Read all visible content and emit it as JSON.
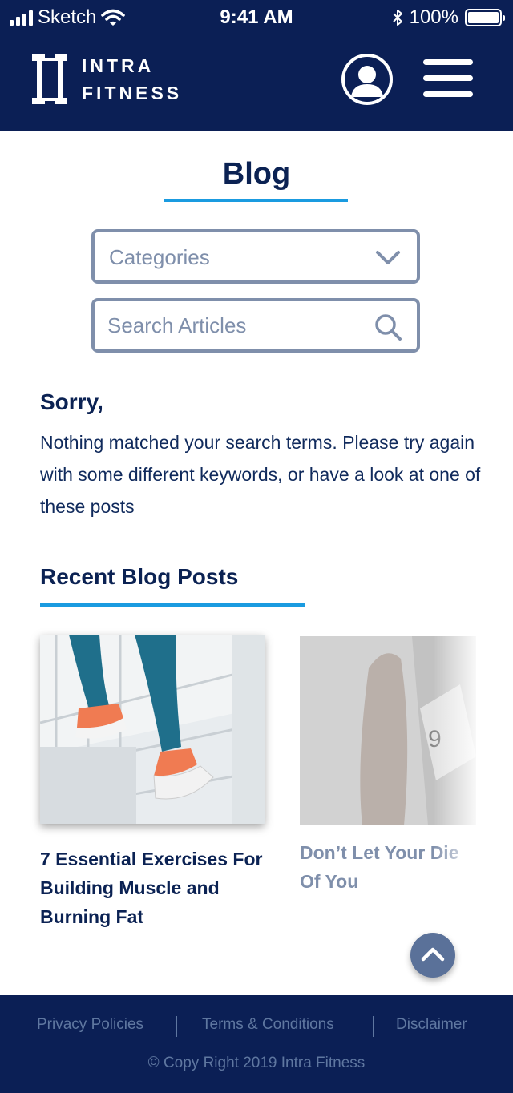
{
  "status_bar": {
    "carrier": "Sketch",
    "time": "9:41 AM",
    "battery": "100%"
  },
  "header": {
    "logo_line1": "INTRA",
    "logo_line2": "FITNESS"
  },
  "page": {
    "title": "Blog"
  },
  "filters": {
    "categories_label": "Categories",
    "search_placeholder": "Search Articles"
  },
  "empty_state": {
    "heading": "Sorry,",
    "message": "Nothing matched your search terms. Please try again with some different keywords, or have a look at one of these posts"
  },
  "recent": {
    "heading": "Recent Blog Posts",
    "posts": [
      {
        "title": "7 Essential Exercises For Building Muscle and Burning Fat"
      },
      {
        "title": "Don’t Let Your Diet Get The Best Of You",
        "visible_title": "Don’t Let Your Die\nOf You"
      }
    ]
  },
  "footer": {
    "links": [
      "Privacy Policies",
      "Terms & Conditions",
      "Disclaimer"
    ],
    "copyright": "© Copy Right 2019 Intra Fitness"
  },
  "colors": {
    "navy": "#0b1f55",
    "accent": "#1a9be0",
    "muted": "#7f8fab"
  },
  "icons": [
    "signal-icon",
    "wifi-icon",
    "bluetooth-icon",
    "battery-icon",
    "profile-icon",
    "menu-icon",
    "chevron-down-icon",
    "search-icon",
    "chevron-up-icon"
  ]
}
